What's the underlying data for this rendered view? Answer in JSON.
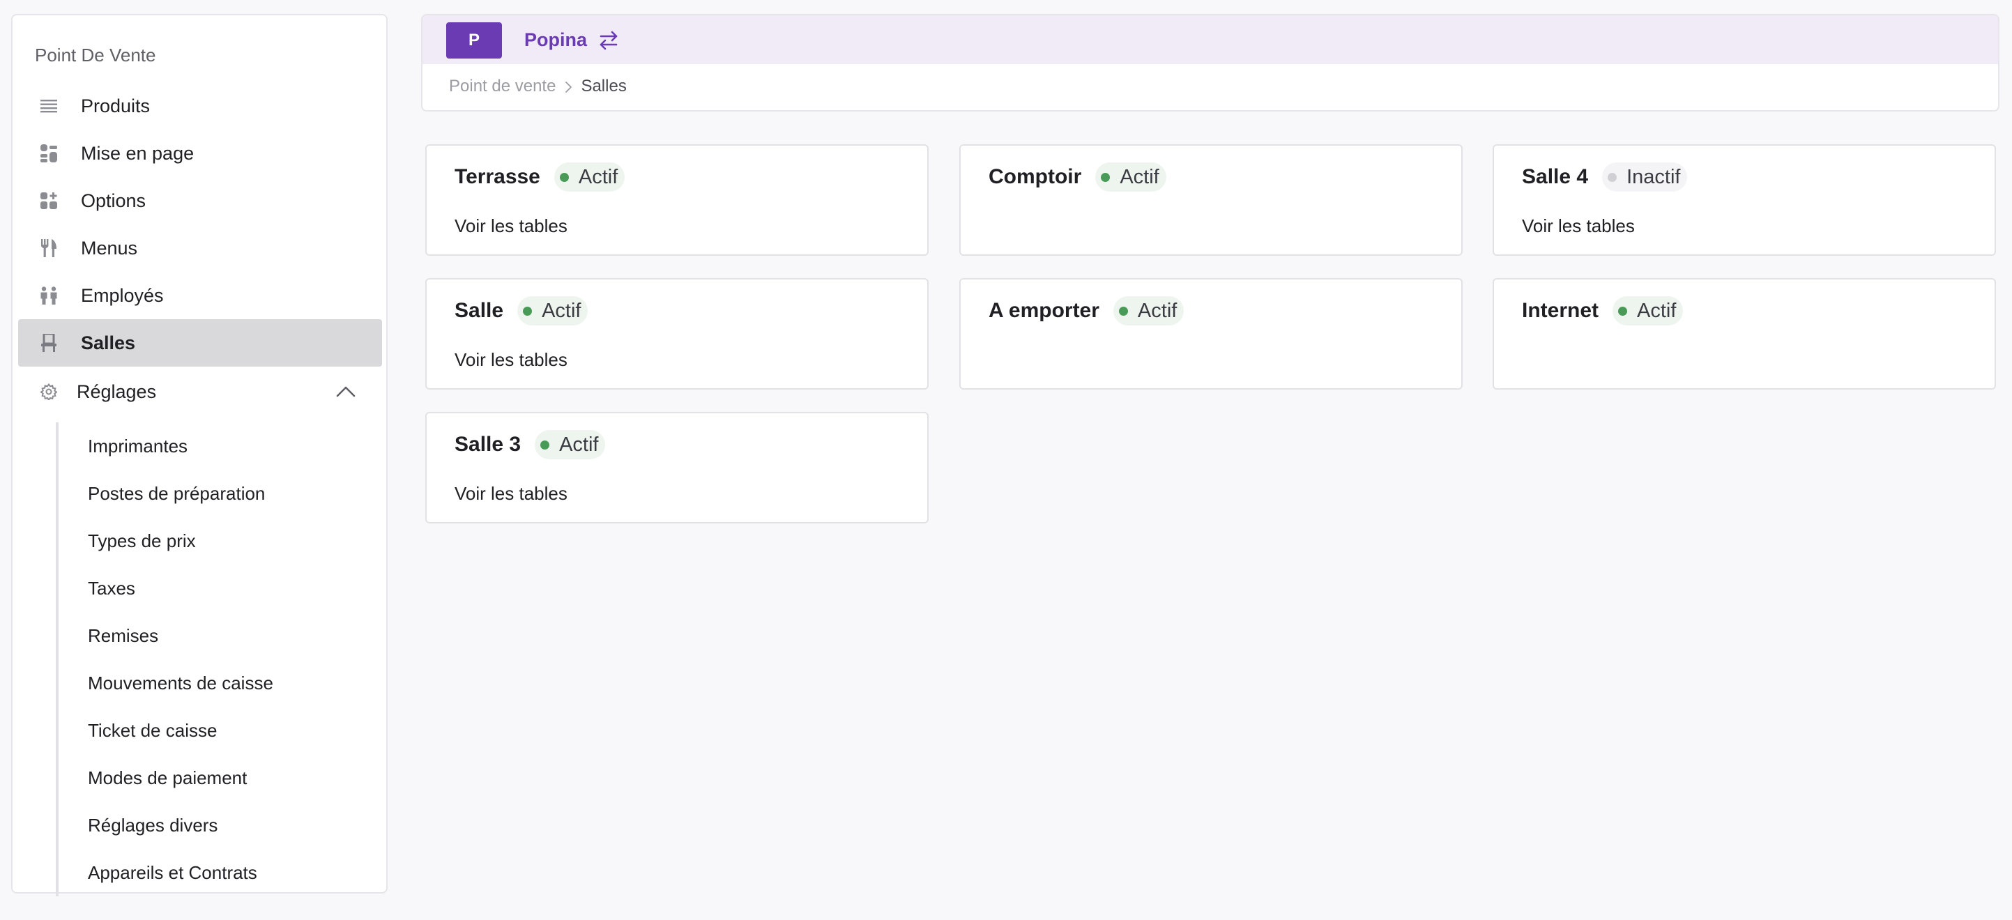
{
  "colors": {
    "brand": "#6a3bb3",
    "active_dot": "#4a9a57",
    "inactive_dot": "#d0d0d4"
  },
  "sidebar": {
    "title": "Point De Vente",
    "items": [
      {
        "label": "Produits",
        "icon": "list-icon"
      },
      {
        "label": "Mise en page",
        "icon": "layout-icon"
      },
      {
        "label": "Options",
        "icon": "options-icon"
      },
      {
        "label": "Menus",
        "icon": "cutlery-icon"
      },
      {
        "label": "Employés",
        "icon": "people-icon"
      },
      {
        "label": "Salles",
        "icon": "chair-icon",
        "active": true
      }
    ],
    "settings": {
      "label": "Réglages",
      "icon": "gear-icon",
      "expanded": true,
      "items": [
        "Imprimantes",
        "Postes de préparation",
        "Types de prix",
        "Taxes",
        "Remises",
        "Mouvements de caisse",
        "Ticket de caisse",
        "Modes de paiement",
        "Réglages divers",
        "Appareils et Contrats"
      ]
    }
  },
  "header": {
    "org_initial": "P",
    "org_name": "Popina",
    "breadcrumb": {
      "parent": "Point de vente",
      "current": "Salles"
    }
  },
  "rooms": [
    {
      "name": "Terrasse",
      "status": "Actif",
      "active": true,
      "link": "Voir les tables"
    },
    {
      "name": "Comptoir",
      "status": "Actif",
      "active": true,
      "link": ""
    },
    {
      "name": "Salle 4",
      "status": "Inactif",
      "active": false,
      "link": "Voir les tables"
    },
    {
      "name": "Salle",
      "status": "Actif",
      "active": true,
      "link": "Voir les tables"
    },
    {
      "name": "A emporter",
      "status": "Actif",
      "active": true,
      "link": ""
    },
    {
      "name": "Internet",
      "status": "Actif",
      "active": true,
      "link": ""
    },
    {
      "name": "Salle 3",
      "status": "Actif",
      "active": true,
      "link": "Voir les tables"
    }
  ]
}
